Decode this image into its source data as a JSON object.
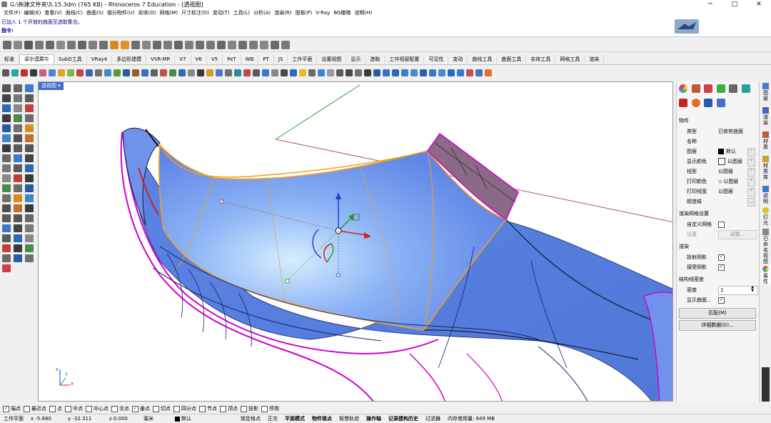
{
  "window": {
    "title": "G:\\新建文件夹\\5.15.3dm (765 KB) - Rhinoceros 7 Education - [透视图]",
    "controls": {
      "minimize": "─",
      "maximize": "□",
      "close": "✕"
    }
  },
  "menu": [
    "文件(F)",
    "编辑(E)",
    "查看(V)",
    "曲线(C)",
    "曲面(S)",
    "细分物件(U)",
    "实体(O)",
    "网格(M)",
    "尺寸标注(D)",
    "变动(T)",
    "工具(L)",
    "分析(A)",
    "渲染(R)",
    "面板(P)",
    "V-Ray",
    "BG楼梯",
    "说明(H)"
  ],
  "command": {
    "history_line": "已加入 1 个开放的曲面至选取集合。",
    "prompt": "指令:"
  },
  "tabs": [
    "标准",
    "卓尔谟犀牛",
    "SubD工具",
    "VRay4",
    "多边形建模",
    "VSR-MR",
    "V7",
    "V6",
    "V5",
    "PeT",
    "WB",
    "PT",
    "JS",
    "工作平面",
    "设置视图",
    "显示",
    "选取",
    "工作视窗配置",
    "可见性",
    "变动",
    "曲线工具",
    "曲面工具",
    "实体工具",
    "网格工具",
    "渲染"
  ],
  "active_tab": "卓尔谟犀牛",
  "viewport": {
    "label": "透视图",
    "label_arrow": "▾",
    "axis_labels": {
      "z": "z",
      "y": "y",
      "x": "x"
    }
  },
  "properties": {
    "section_object": "物件",
    "rows": [
      {
        "key": "类型",
        "value": "已修剪曲面"
      },
      {
        "key": "名称",
        "value": ""
      },
      {
        "key": "图层",
        "value": "默认"
      },
      {
        "key": "显示颜色",
        "value": "以图层"
      },
      {
        "key": "线型",
        "value": "以图层"
      },
      {
        "key": "打印颜色",
        "value": "以图层"
      },
      {
        "key": "打印线宽",
        "value": "以图层"
      },
      {
        "key": "超连结",
        "value": ""
      }
    ],
    "section_mesh": "渲染网格设置",
    "custom_mesh_label": "自定义网格",
    "settings_label": "设置",
    "adjust_button": "调整...",
    "section_render": "渲染",
    "cast_shadows": "投射阴影",
    "receive_shadows": "接受阴影",
    "section_isocurve": "结构线密度",
    "density_label": "密度",
    "density_value": "1",
    "show_surface_label": "显示曲面...",
    "match_button": "匹配(M)",
    "details_button": "详细数据(D)..."
  },
  "side_tabs": [
    "图层",
    "渲染",
    "材质",
    "材质库",
    "说明",
    "灯光",
    "已命名视图",
    "属性"
  ],
  "osnaps": [
    {
      "label": "端点",
      "checked": true
    },
    {
      "label": "最近点",
      "checked": false
    },
    {
      "label": "点",
      "checked": false
    },
    {
      "label": "中点",
      "checked": false
    },
    {
      "label": "中心点",
      "checked": false
    },
    {
      "label": "交点",
      "checked": false
    },
    {
      "label": "垂点",
      "checked": true
    },
    {
      "label": "切点",
      "checked": false
    },
    {
      "label": "四分点",
      "checked": false
    },
    {
      "label": "节点",
      "checked": false
    },
    {
      "label": "顶点",
      "checked": false
    },
    {
      "label": "投影",
      "checked": false
    },
    {
      "label": "停用",
      "checked": false
    }
  ],
  "status": {
    "cplane": "工作平面",
    "x": "x -5.680",
    "y": "y -32.311",
    "z": "z 0.000",
    "units": "毫米",
    "layer": "默认",
    "grid_snap": "锁定格点",
    "ortho": "正交",
    "planar": "平面模式",
    "osnap": "物件锁点",
    "smarttrack": "智慧轨迹",
    "gumball": "操作轴",
    "history": "记录建构历史",
    "filter": "过滤器",
    "memory": "内存使用量: 649 MB"
  },
  "colors": {
    "surface": "#7fa6f2",
    "surface_highlight": "#cfe8ff",
    "edge_selected": "#f0a020",
    "edge_naked": "#d000d0",
    "viewport_label": "#3f6ed0"
  }
}
